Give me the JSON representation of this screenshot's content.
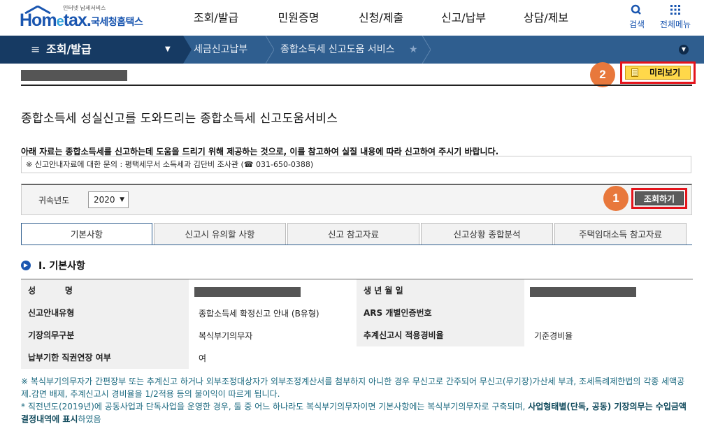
{
  "header": {
    "logo_small": "인터넷 납세서비스",
    "logo_main_a": "Hom",
    "logo_main_e": "e",
    "logo_main_b": "tax.",
    "logo_kr": "국세청홈택스",
    "gnb": [
      "조회/발급",
      "민원증명",
      "신청/제출",
      "신고/납부",
      "상담/제보"
    ],
    "search_label": "검색",
    "menu_label": "전체메뉴"
  },
  "navbar": {
    "primary": "조회/발급",
    "crumb1": "세금신고납부",
    "crumb2": "종합소득세 신고도움 서비스"
  },
  "preview": {
    "label": "미리보기",
    "badge": "2"
  },
  "heading": "종합소득세 성실신고를 도와드리는 종합소득세 신고도움서비스",
  "notice": {
    "bold": "아래 자료는 종합소득세를 신고하는데 도움을 드리기 위해 제공하는 것으로, 이를 참고하여 실질 내용에 따라 신고하여 주시기 바랍니다.",
    "contact": "※ 신고안내자료에 대한 문의 : 평택세무서 소득세과 김단비 조사관 (☎ 031-650-0388)"
  },
  "search": {
    "year_label": "귀속년도",
    "year_value": "2020",
    "query_label": "조회하기",
    "badge": "1"
  },
  "tabs": [
    "기본사항",
    "신고시 유의할 사항",
    "신고 참고자료",
    "신고상황 종합분석",
    "주택임대소득 참고자료"
  ],
  "section_title": "Ⅰ. 기본사항",
  "info": {
    "name_label": "성          명",
    "birth_label": "생 년 월 일",
    "guide_type_label": "신고안내유형",
    "guide_type_value": "종합소득세 확정신고 안내 (B유형)",
    "ars_label": "ARS 개별인증번호",
    "ars_value": "",
    "bookkeeping_label": "기장의무구분",
    "bookkeeping_value": "복식부기의무자",
    "estimate_label": "추계신고시 적용경비율",
    "estimate_value": "기준경비율",
    "extension_label": "납부기한 직권연장 여부",
    "extension_value": "여"
  },
  "notes": {
    "line1": "※ 복식부기의무자가 간편장부 또는 추계신고 하거나 외부조정대상자가 외부조정계산서를 첨부하지 아니한 경우 무신고로 간주되어 무신고(무기장)가산세 부과, 조세특례제한법의 각종 세액공제.감면 배제, 추계신고시 경비율을 1/2적용 등의 불이익이 따르게 됩니다.",
    "line2_a": "* 직전년도(2019년)에 공동사업과 단독사업을 운영한 경우, 둘 중 어느 하나라도 복식부기의무자이면 기본사항에는 복식부기의무자로 구축되며, ",
    "line2_b": "사업형태별(단독, 공동) 기장의무는 수입금액 결정내역에 표시",
    "line2_c": "하였음"
  },
  "colors": {
    "brand": "#1a56b0",
    "nav_dark": "#163a63",
    "nav": "#2f5e8f",
    "highlight": "#e4141c",
    "badge": "#e8783c",
    "preview_button": "#ffd84a"
  }
}
